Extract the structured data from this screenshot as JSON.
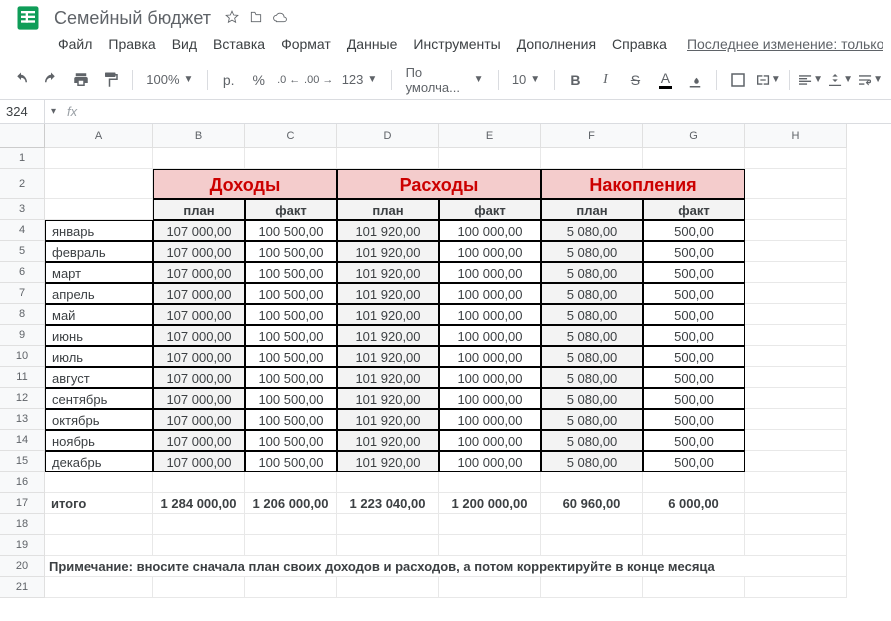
{
  "doc_title": "Семейный бюджет",
  "menu": {
    "file": "Файл",
    "edit": "Правка",
    "view": "Вид",
    "insert": "Вставка",
    "format": "Формат",
    "data": "Данные",
    "tools": "Инструменты",
    "addons": "Дополнения",
    "help": "Справка"
  },
  "last_edit": "Последнее изменение: только",
  "toolbar": {
    "zoom": "100%",
    "currency": "р.",
    "percent": "%",
    "dec_dec": ",0",
    "dec_inc": ",00",
    "num_fmt": "123",
    "font": "По умолча...",
    "size": "10"
  },
  "namebox": "324",
  "fx_label": "fx",
  "cols": [
    "A",
    "B",
    "C",
    "D",
    "E",
    "F",
    "G",
    "H"
  ],
  "headers": {
    "income": "Доходы",
    "expense": "Расходы",
    "savings": "Накопления",
    "plan": "план",
    "fact": "факт"
  },
  "months": [
    "январь",
    "февраль",
    "март",
    "апрель",
    "май",
    "июнь",
    "июль",
    "август",
    "сентябрь",
    "октябрь",
    "ноябрь",
    "декабрь"
  ],
  "vals": {
    "inc_plan": "107 000,00",
    "inc_fact": "100 500,00",
    "exp_plan": "101 920,00",
    "exp_fact": "100 000,00",
    "sav_plan": "5 080,00",
    "sav_fact": "500,00"
  },
  "totals": {
    "label": "итого",
    "inc_plan": "1 284 000,00",
    "inc_fact": "1 206 000,00",
    "exp_plan": "1 223 040,00",
    "exp_fact": "1 200 000,00",
    "sav_plan": "60 960,00",
    "sav_fact": "6 000,00"
  },
  "note": "Примечание: вносите сначала план своих доходов и расходов, а потом корректируйте  в конце месяца"
}
